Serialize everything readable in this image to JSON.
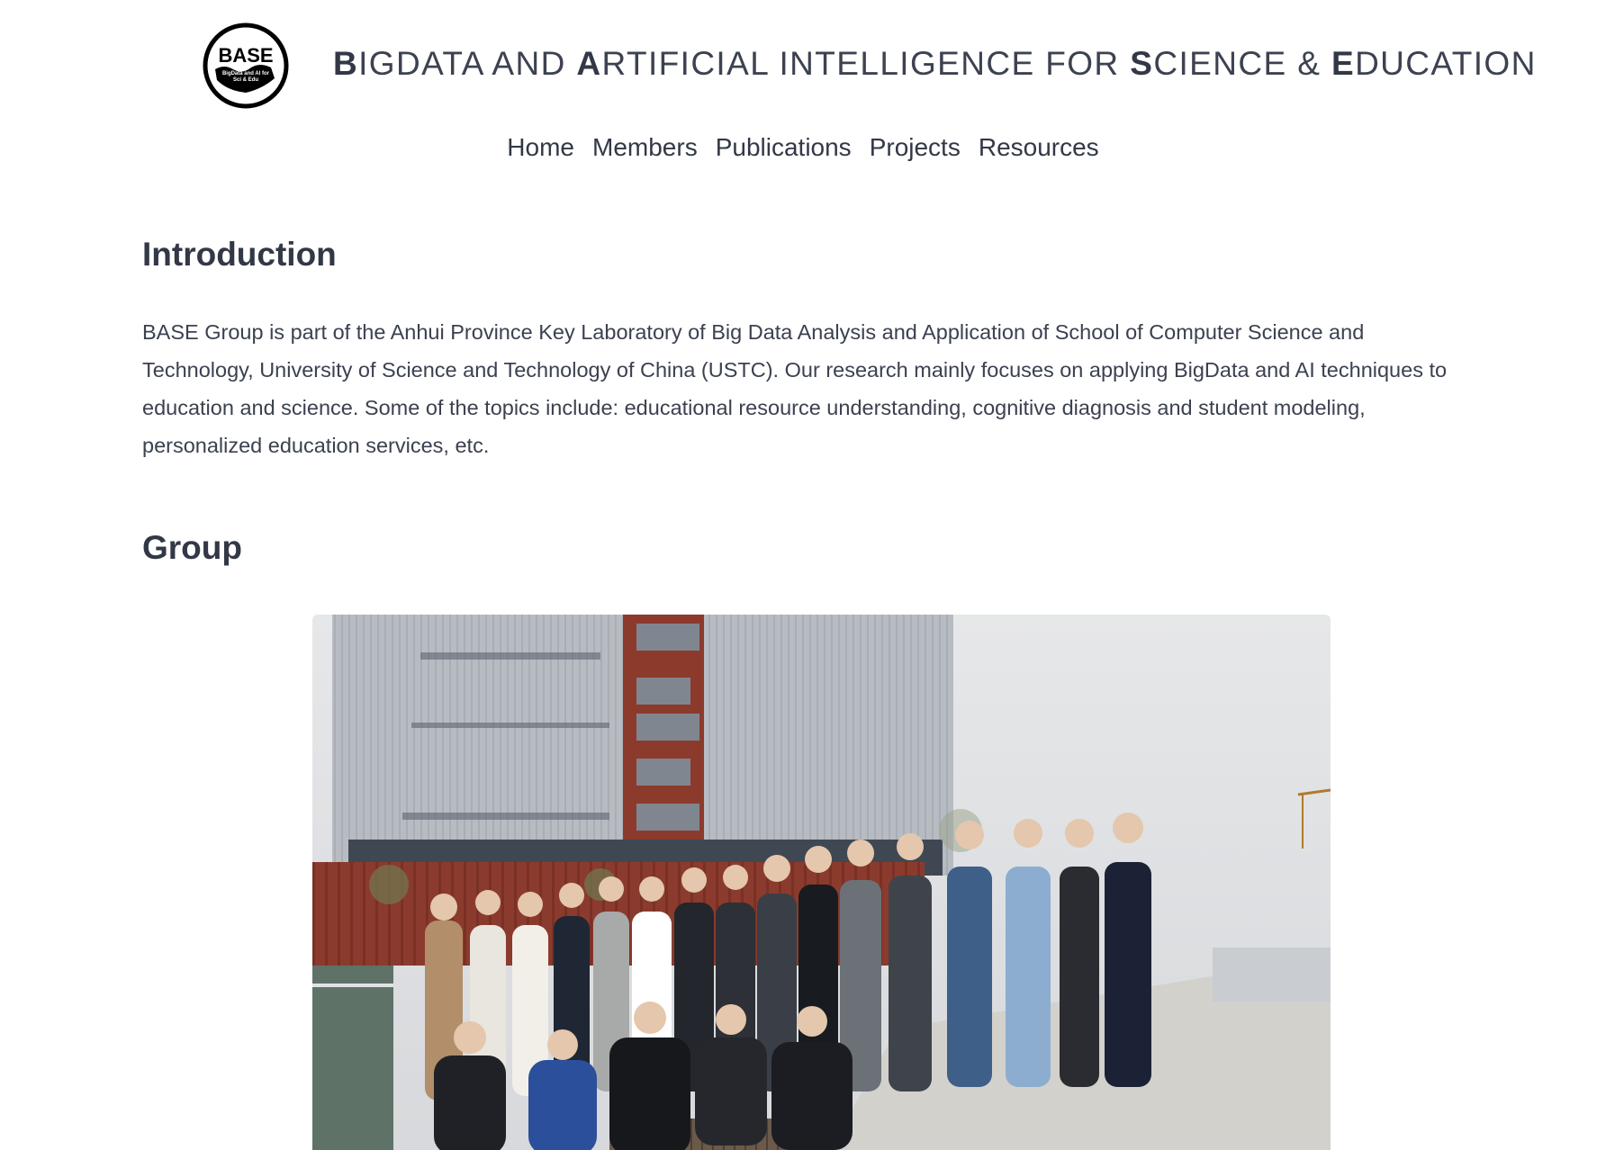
{
  "header": {
    "logo": {
      "text": "BASE",
      "subtext_line1": "BigData and AI for",
      "subtext_line2": "Sci & Edu"
    },
    "title_parts": [
      {
        "cap": "B",
        "rest": "IGDATA AND "
      },
      {
        "cap": "A",
        "rest": "RTIFICIAL INTELLIGENCE FOR "
      },
      {
        "cap": "S",
        "rest": "CIENCE & "
      },
      {
        "cap": "E",
        "rest": "DUCATION"
      }
    ]
  },
  "nav": {
    "items": [
      {
        "label": "Home"
      },
      {
        "label": "Members"
      },
      {
        "label": "Publications"
      },
      {
        "label": "Projects"
      },
      {
        "label": "Resources"
      }
    ]
  },
  "main": {
    "introduction": {
      "heading": "Introduction",
      "body": "BASE Group is part of the Anhui Province Key Laboratory of Big Data Analysis and Application of School of Computer Science and Technology, University of Science and Technology of China (USTC). Our research mainly focuses on applying BigData and AI techniques to education and science. Some of the topics include: educational resource understanding, cognitive diagnosis and student modeling, personalized education services, etc."
    },
    "group": {
      "heading": "Group"
    }
  },
  "colors": {
    "text": "#323846",
    "background": "#ffffff",
    "building_facade": "#b9bec4",
    "brick_wall": "#8a3a2c",
    "sky": "#dcdde0"
  }
}
